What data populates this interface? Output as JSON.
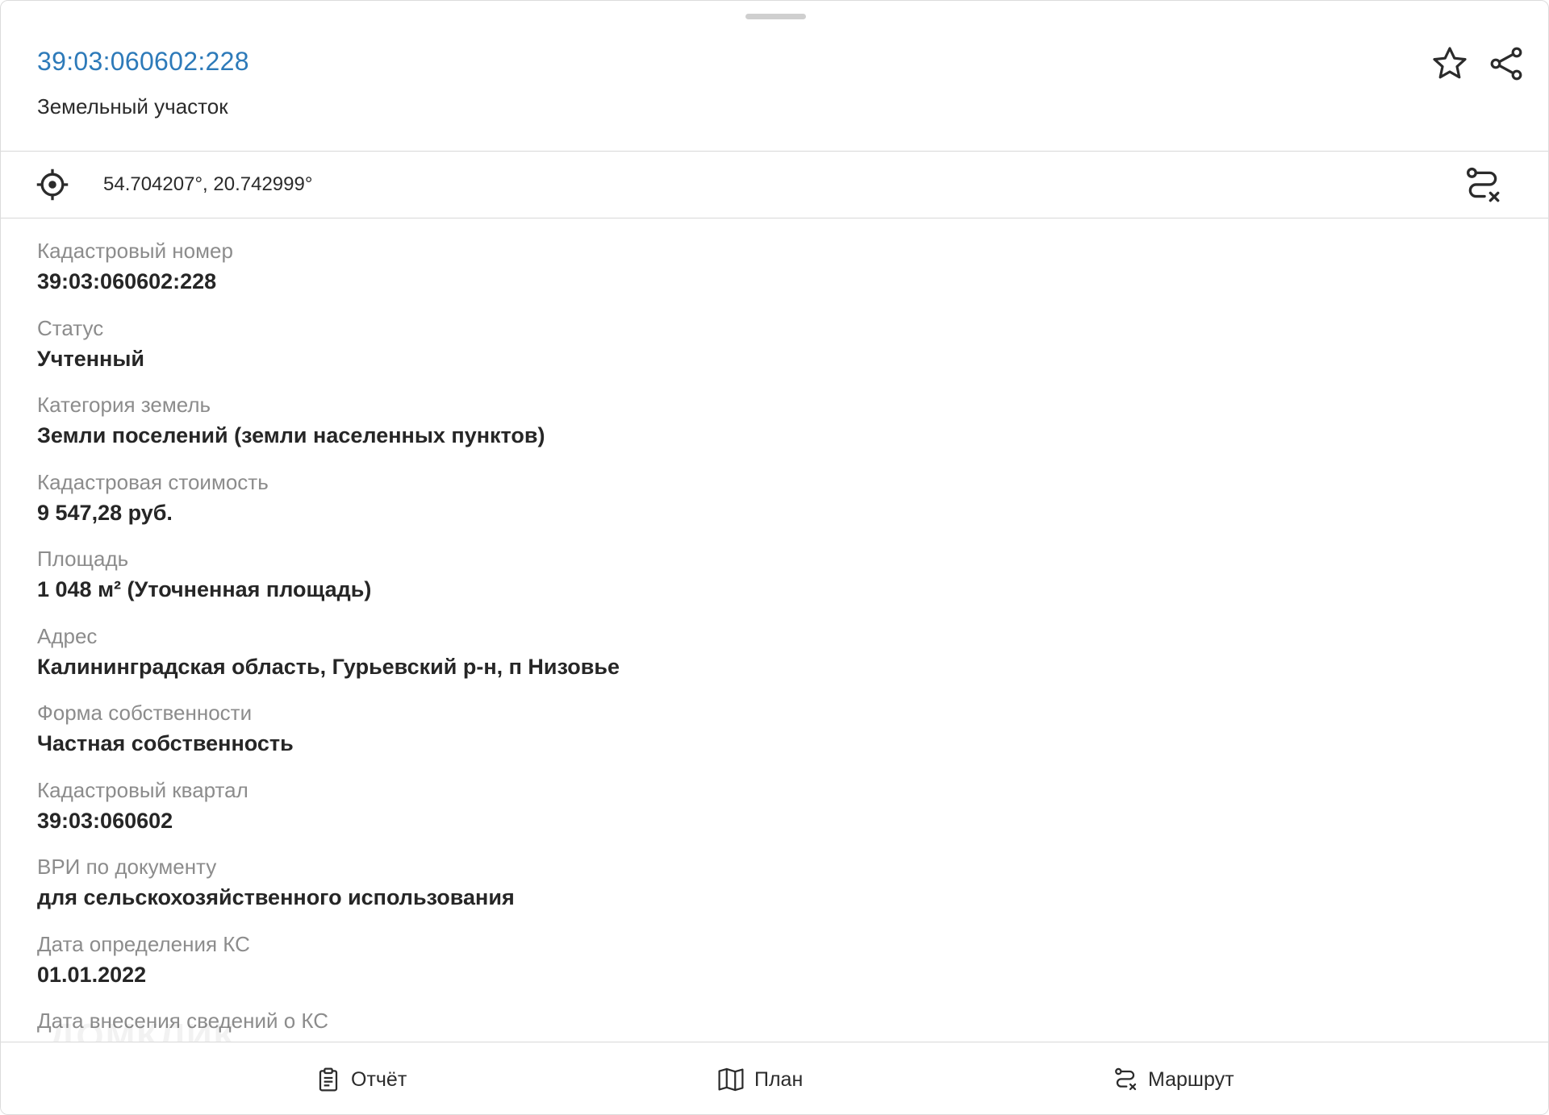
{
  "header": {
    "title": "39:03:060602:228",
    "subtitle": "Земельный участок"
  },
  "coordinates": {
    "text": "54.704207°, 20.742999°"
  },
  "fields": [
    {
      "label": "Кадастровый номер",
      "value": "39:03:060602:228"
    },
    {
      "label": "Статус",
      "value": "Учтенный"
    },
    {
      "label": "Категория земель",
      "value": "Земли поселений (земли населенных пунктов)"
    },
    {
      "label": "Кадастровая стоимость",
      "value": "9 547,28 руб."
    },
    {
      "label": "Площадь",
      "value": "1 048 м² (Уточненная площадь)"
    },
    {
      "label": "Адрес",
      "value": "Калининградская область, Гурьевский р-н, п Низовье"
    },
    {
      "label": "Форма собственности",
      "value": "Частная собственность"
    },
    {
      "label": "Кадастровый квартал",
      "value": "39:03:060602"
    },
    {
      "label": "ВРИ по документу",
      "value": "для сельскохозяйственного использования"
    },
    {
      "label": "Дата определения КС",
      "value": "01.01.2022"
    },
    {
      "label": "Дата внесения сведений о КС",
      "value": ""
    }
  ],
  "bottom_bar": {
    "report_label": "Отчёт",
    "plan_label": "План",
    "route_label": "Маршрут"
  },
  "watermark": "ДОМКЛИК",
  "colors": {
    "accent": "#2d7ab9",
    "label": "#8c8c8c",
    "value": "#262626"
  },
  "icons": [
    "star-icon",
    "share-icon",
    "target-icon",
    "route-icon",
    "clipboard-icon",
    "map-icon"
  ]
}
